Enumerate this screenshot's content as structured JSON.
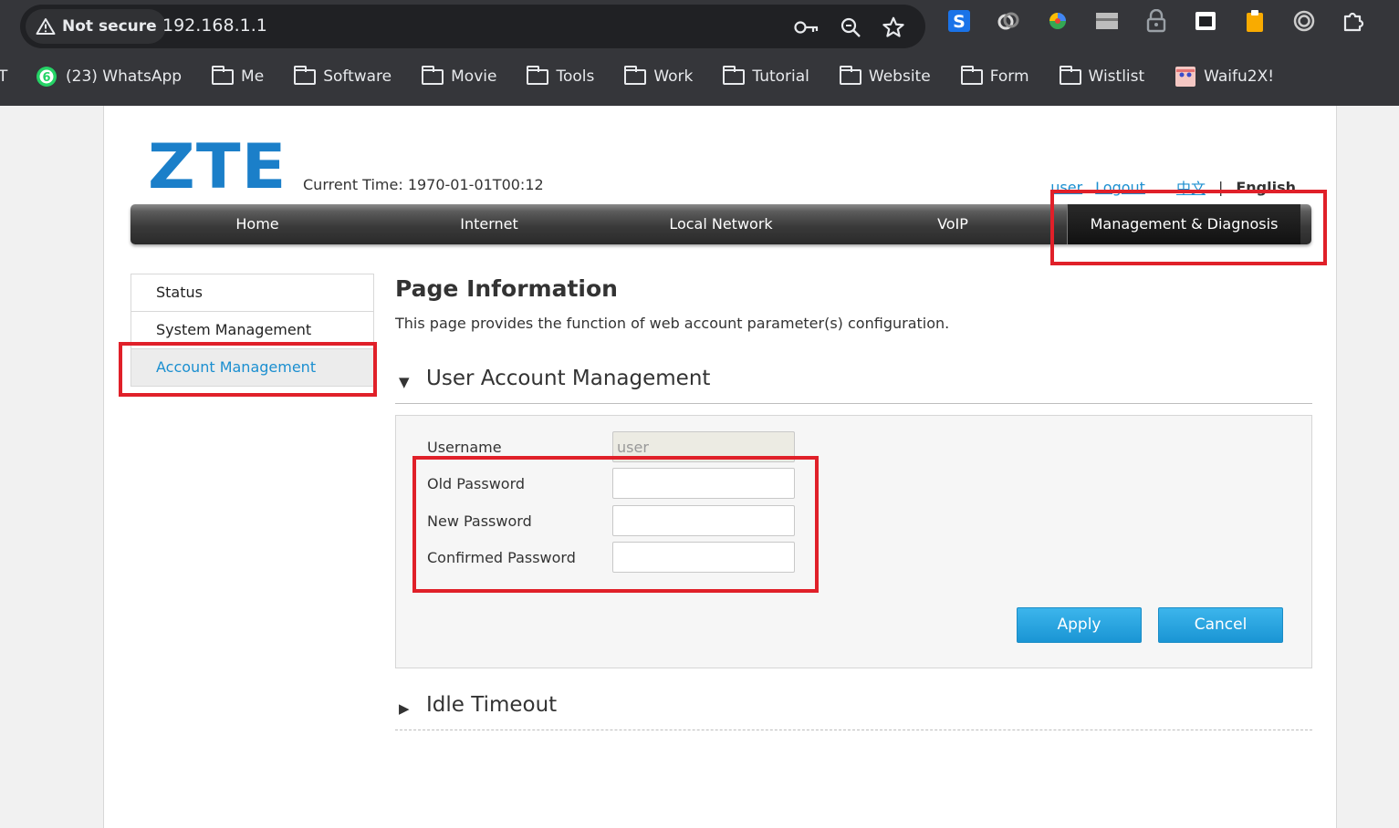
{
  "browser": {
    "security_label": "Not secure",
    "url": "192.168.1.1",
    "bookmarks": [
      {
        "label": "(23) WhatsApp",
        "icon": "whatsapp-icon",
        "badge": "6"
      },
      {
        "label": "Me",
        "icon": "folder-icon"
      },
      {
        "label": "Software",
        "icon": "folder-icon"
      },
      {
        "label": "Movie",
        "icon": "folder-icon"
      },
      {
        "label": "Tools",
        "icon": "folder-icon"
      },
      {
        "label": "Work",
        "icon": "folder-icon"
      },
      {
        "label": "Tutorial",
        "icon": "folder-icon"
      },
      {
        "label": "Website",
        "icon": "folder-icon"
      },
      {
        "label": "Form",
        "icon": "folder-icon"
      },
      {
        "label": "Wistlist",
        "icon": "folder-icon"
      },
      {
        "label": "Waifu2X!",
        "icon": "waifu-icon"
      }
    ],
    "bookmark_cut_label": "T"
  },
  "header": {
    "logo": "ZTE",
    "current_time": "Current Time: 1970-01-01T00:12",
    "user_link": "user",
    "logout_link": "Logout",
    "lang_zh": "中文",
    "lang_sep": "|",
    "lang_en": "English"
  },
  "nav": {
    "items": [
      "Home",
      "Internet",
      "Local Network",
      "VoIP",
      "Management & Diagnosis"
    ],
    "active": "Management & Diagnosis"
  },
  "sidebar": {
    "items": [
      "Status",
      "System Management",
      "Account Management"
    ],
    "active": "Account Management"
  },
  "content": {
    "title": "Page Information",
    "description": "This page provides the function of web account parameter(s) configuration.",
    "section_user": "User Account Management",
    "section_idle": "Idle Timeout",
    "form": {
      "username_label": "Username",
      "username_value": "user",
      "old_password_label": "Old Password",
      "new_password_label": "New Password",
      "confirm_password_label": "Confirmed Password"
    },
    "apply_label": "Apply",
    "cancel_label": "Cancel"
  },
  "colors": {
    "accent": "#1b8fd0",
    "logo": "#1b7fc9",
    "highlight": "#e02029",
    "button": "#2aa5e0"
  }
}
